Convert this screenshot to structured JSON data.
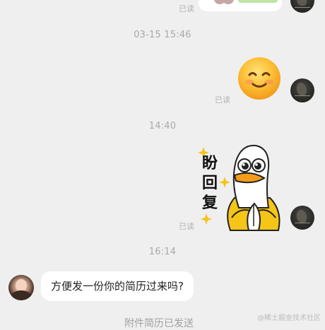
{
  "chat": {
    "read_label": "已读",
    "timestamps": [
      "03-15 15:46",
      "14:40",
      "16:14"
    ],
    "sticker_text": "盼回复",
    "incoming_message": "方便发一份你的简历过来吗?",
    "partial_notice": "附件简历已发送"
  },
  "watermark": "@稀土掘金技术社区",
  "colors": {
    "background": "#efefef",
    "bubble": "#ffffff",
    "emoji_face": "#f7b733",
    "duck_yellow": "#f5c518"
  }
}
